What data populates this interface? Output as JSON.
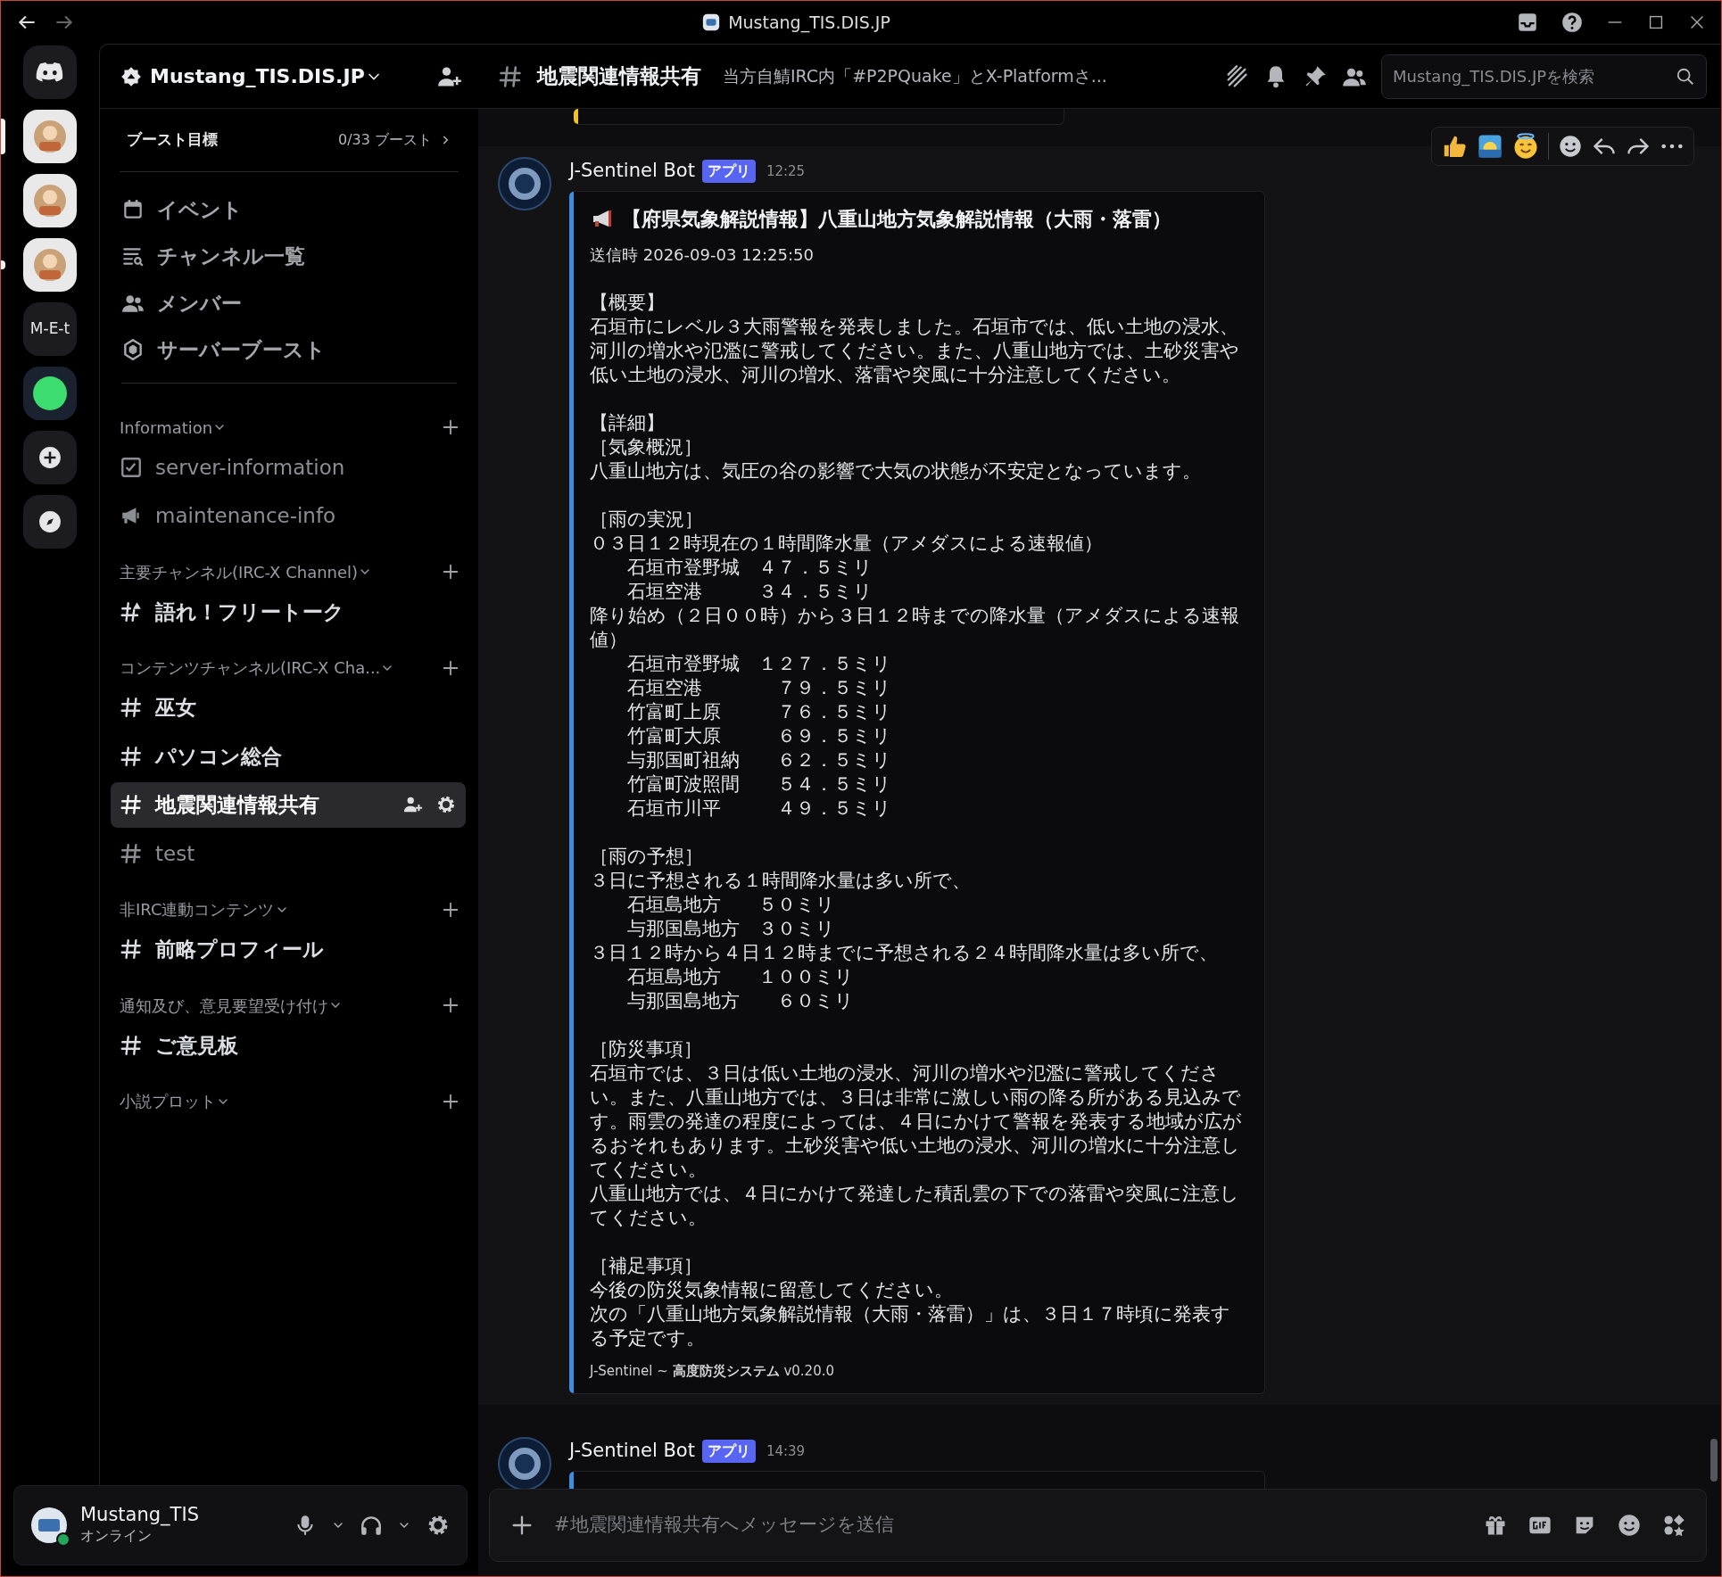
{
  "window": {
    "title": "Mustang_TIS.DIS.JP"
  },
  "server_rail": [
    {
      "kind": "home",
      "selected": false,
      "unread": false
    },
    {
      "kind": "image",
      "selected": true,
      "unread": false
    },
    {
      "kind": "image",
      "selected": false,
      "unread": false
    },
    {
      "kind": "image",
      "selected": false,
      "unread": true
    },
    {
      "kind": "text",
      "label": "M-E-t",
      "selected": false,
      "unread": false
    },
    {
      "kind": "status",
      "selected": false,
      "unread": false
    },
    {
      "kind": "add",
      "selected": false,
      "unread": false
    },
    {
      "kind": "discover",
      "selected": false,
      "unread": false
    }
  ],
  "server": {
    "name": "Mustang_TIS.DIS.JP",
    "boost_label": "ブースト目標",
    "boost_count": "0/33 ブースト"
  },
  "shortcuts": [
    {
      "kind": "event",
      "label": "イベント"
    },
    {
      "kind": "browse",
      "label": "チャンネル一覧"
    },
    {
      "kind": "members",
      "label": "メンバー"
    },
    {
      "kind": "boost",
      "label": "サーバーブースト"
    }
  ],
  "categories": [
    {
      "name": "Information",
      "channels": [
        {
          "kind": "rules",
          "name": "server-information",
          "unread": false,
          "selected": false
        },
        {
          "kind": "announcement",
          "name": "maintenance-info",
          "unread": false,
          "selected": false
        }
      ]
    },
    {
      "name": "主要チャンネル(IRC-X Channel)",
      "channels": [
        {
          "kind": "thread",
          "name": "語れ！フリートーク",
          "unread": true,
          "selected": false
        }
      ]
    },
    {
      "name": "コンテンツチャンネル(IRC-X Cha...",
      "channels": [
        {
          "kind": "text",
          "name": "巫女",
          "unread": true,
          "selected": false
        },
        {
          "kind": "text",
          "name": "パソコン総合",
          "unread": true,
          "selected": false
        },
        {
          "kind": "text",
          "name": "地震関連情報共有",
          "unread": true,
          "selected": true
        },
        {
          "kind": "text",
          "name": "test",
          "unread": false,
          "selected": false
        }
      ]
    },
    {
      "name": "非IRC連動コンテンツ",
      "channels": [
        {
          "kind": "text",
          "name": "前略プロフィール",
          "unread": true,
          "selected": false
        }
      ]
    },
    {
      "name": "通知及び、意見要望受け付け",
      "channels": [
        {
          "kind": "text",
          "name": "ご意見板",
          "unread": true,
          "selected": false
        }
      ]
    },
    {
      "name": "小説プロット"
    }
  ],
  "user": {
    "name": "Mustang_TIS",
    "status": "オンライン"
  },
  "header": {
    "channel": "地震関連情報共有",
    "topic": "当方自鯖IRC内「#P2PQuake」とX-Platformさ...",
    "search_placeholder": "Mustang_TIS.DIS.JPを検索"
  },
  "messages": [
    {
      "kind": "tail",
      "embed": {
        "color": "#f0c419"
      }
    },
    {
      "kind": "full",
      "hovered": true,
      "author": "J-Sentinel Bot",
      "badge": "アプリ",
      "time": "12:25",
      "embed": {
        "color": "#3b8ee0",
        "title": "【府県気象解説情報】八重山地方気象解説情報（大雨・落雷）",
        "sent": "送信時 2026-09-03 12:25:50",
        "blocks": [
          [
            "【概要】",
            "石垣市にレベル３大雨警報を発表しました。石垣市では、低い土地の浸水、河川の増水や氾濫に警戒してください。また、八重山地方では、土砂災害や低い土地の浸水、河川の増水、落雷や突風に十分注意してください。"
          ],
          [
            "【詳細】",
            "［気象概況］",
            "八重山地方は、気圧の谷の影響で大気の状態が不安定となっています。"
          ],
          [
            "［雨の実況］",
            "０３日１２時現在の１時間降水量（アメダスによる速報値）",
            "　　石垣市登野城　４７．５ミリ",
            "　　石垣空港　　　３４．５ミリ",
            "降り始め（２日００時）から３日１２時までの降水量（アメダスによる速報値）",
            "　　石垣市登野城　１２７．５ミリ",
            "　　石垣空港　　　　７９．５ミリ",
            "　　竹富町上原　　　７６．５ミリ",
            "　　竹富町大原　　　６９．５ミリ",
            "　　与那国町祖納　　６２．５ミリ",
            "　　竹富町波照間　　５４．５ミリ",
            "　　石垣市川平　　　４９．５ミリ"
          ],
          [
            "［雨の予想］",
            "３日に予想される１時間降水量は多い所で、",
            "　　石垣島地方　　５０ミリ",
            "　　与那国島地方　３０ミリ",
            "３日１２時から４日１２時までに予想される２４時間降水量は多い所で、",
            "　　石垣島地方　　１００ミリ",
            "　　与那国島地方　　６０ミリ"
          ],
          [
            "［防災事項］",
            "石垣市では、３日は低い土地の浸水、河川の増水や氾濫に警戒してください。また、八重山地方では、３日は非常に激しい雨の降る所がある見込みです。雨雲の発達の程度によっては、４日にかけて警報を発表する地域が広がるおそれもあります。土砂災害や低い土地の浸水、河川の増水に十分注意してください。",
            "八重山地方では、４日にかけて発達した積乱雲の下での落雷や突風に注意してください。"
          ],
          [
            "［補足事項］",
            "今後の防災気象情報に留意してください。",
            "次の「八重山地方気象解説情報（大雨・落雷）」は、３日１７時頃に発表する予定です。"
          ]
        ],
        "footer": "J-Sentinel ~ **高度防災システム** v0.20.0"
      }
    },
    {
      "kind": "head",
      "hovered": false,
      "author": "J-Sentinel Bot",
      "badge": "アプリ",
      "time": "14:39",
      "embed": {
        "color": "#3b8ee0"
      }
    }
  ],
  "composer": {
    "placeholder": "#地震関連情報共有へメッセージを送信"
  }
}
